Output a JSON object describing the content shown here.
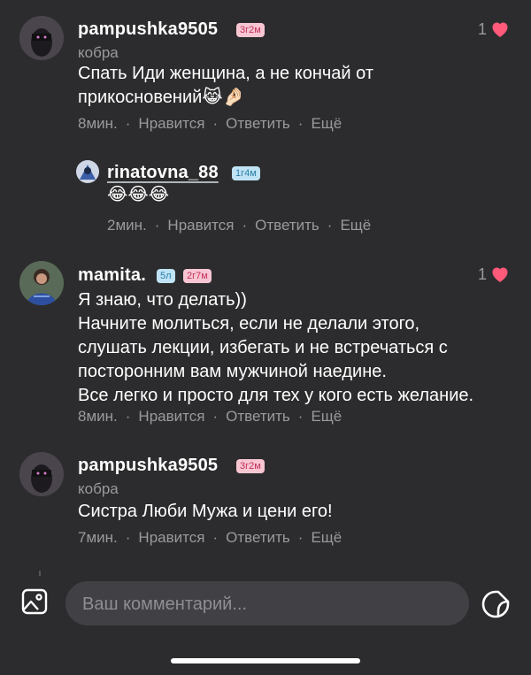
{
  "comments": [
    {
      "username": "pampushka9505",
      "badge": "3г2м",
      "subtitle": "кобра",
      "text_lines": [
        "Спать Иди женщина, а не кончай от",
        "прикосновений😹🤌🏻"
      ],
      "time": "8мин.",
      "like_label": "Нравится",
      "reply_label": "Ответить",
      "more_label": "Ещё",
      "likes": "1"
    },
    {
      "username": "mamita.",
      "badge_blue": "5л",
      "badge": "2г7м",
      "text_lines": [
        "Я знаю, что делать))",
        "Начните молиться, если не делали этого,",
        "слушать лекции, избегать и не встречаться с",
        "посторонним вам мужчиной наедине.",
        "Все легко и просто для тех у кого есть желание."
      ],
      "time": "8мин.",
      "like_label": "Нравится",
      "reply_label": "Ответить",
      "more_label": "Ещё",
      "likes": "1"
    },
    {
      "username": "pampushka9505",
      "badge": "3г2м",
      "subtitle": "кобра",
      "text_lines": [
        "Систра Люби Мужа и цени его!"
      ],
      "time": "7мин.",
      "like_label": "Нравится",
      "reply_label": "Ответить",
      "more_label": "Ещё"
    }
  ],
  "reply": {
    "username": "rinatovna_88",
    "badge": "1г4м",
    "text": "😂😂😂",
    "time": "2мин.",
    "like_label": "Нравится",
    "reply_label": "Ответить",
    "more_label": "Ещё"
  },
  "composer": {
    "placeholder": "Ваш комментарий...",
    "image_icon": "image-icon",
    "sticker_icon": "sticker-icon"
  },
  "colors": {
    "background": "#2c2c2e",
    "heart": "#ff5a7a",
    "muted_text": "#9a9a9e"
  }
}
